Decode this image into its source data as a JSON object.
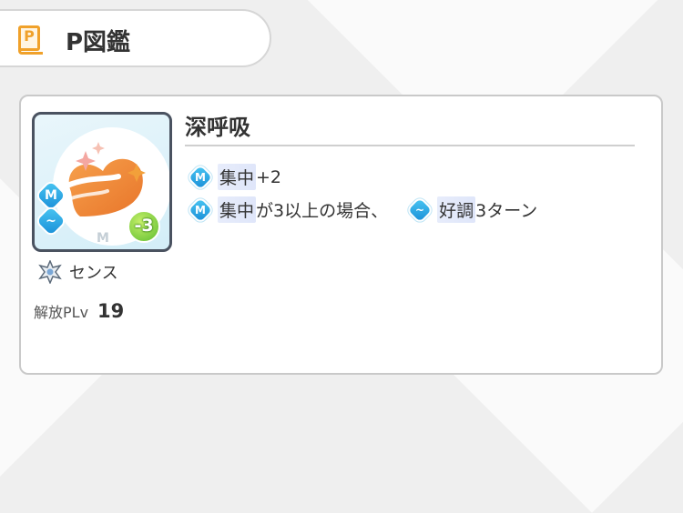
{
  "header": {
    "icon_letter": "P",
    "title": "P図鑑"
  },
  "card": {
    "skill_name": "深呼吸",
    "cost": "-3",
    "image_mark": "M",
    "type_label": "センス",
    "level_label": "解放PLv",
    "level_value": "19",
    "effects": [
      {
        "icon": "concentration-icon",
        "icon_letter": "M",
        "keyword": "集中",
        "text": "+2"
      },
      {
        "icon": "concentration-icon",
        "icon_letter": "M",
        "keyword": "集中",
        "text": "が3以上の場合、",
        "icon2": "good-condition-icon",
        "keyword2": "好調",
        "text2": "3ターン"
      }
    ]
  },
  "colors": {
    "accent": "#f0a12a",
    "effect_icon": "#1a8fd8",
    "cost_badge": "#5cbd2f",
    "heart": "#f08a3a"
  }
}
